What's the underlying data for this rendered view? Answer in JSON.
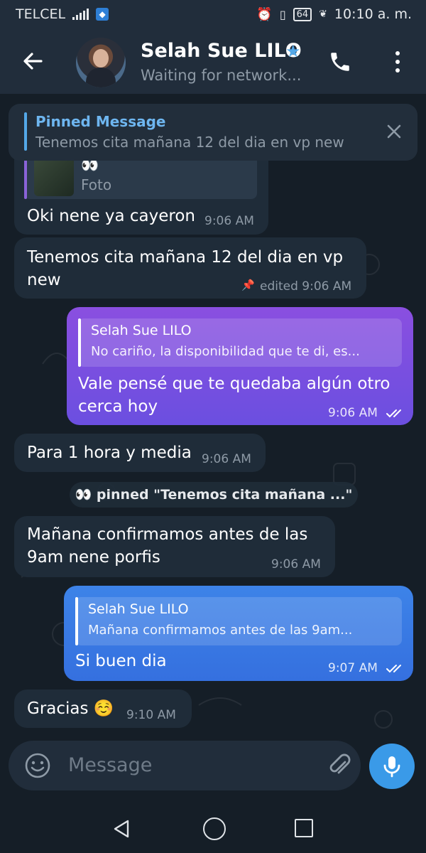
{
  "status_bar": {
    "carrier": "TELCEL",
    "battery": "64",
    "time": "10:10 a. m."
  },
  "header": {
    "contact_name": "Selah Sue LILO",
    "status": "Waiting for network..."
  },
  "pinned": {
    "title": "Pinned Message",
    "text": "Tenemos cita mañana 12 del dia en vp new"
  },
  "messages": {
    "m1": {
      "reply_label": "Foto",
      "reply_emoji": "👀",
      "text": "Oki nene ya cayeron",
      "time": "9:06 AM"
    },
    "m2": {
      "text_line1": "Tenemos cita mañana 12 del dia en vp",
      "text_line2": "new",
      "time": "edited 9:06 AM"
    },
    "m3": {
      "reply_name": "Selah Sue LILO",
      "reply_text": "No cariño, la disponibilidad que te di, es...",
      "text_line1": "Vale pensé que te quedaba algún otro",
      "text_line2": "cerca hoy",
      "time": "9:06 AM"
    },
    "m4": {
      "text": "Para 1 hora y media",
      "time": "9:06 AM"
    },
    "service": "👀 pinned \"Tenemos cita mañana ...\"",
    "m5": {
      "text_line1": "Mañana confirmamos antes de las",
      "text_line2": "9am nene porfis",
      "time": "9:06 AM"
    },
    "m6": {
      "reply_name": "Selah Sue LILO",
      "reply_text": "Mañana confirmamos antes de las 9am...",
      "text": "Si buen dia",
      "time": "9:07 AM"
    },
    "m7": {
      "text": "Gracias ☺️",
      "time": "9:10 AM"
    }
  },
  "composer": {
    "placeholder": "Message"
  },
  "colors": {
    "background": "#151e27",
    "header": "#212d3b",
    "incoming_bubble": "#1f2c39",
    "outgoing_purple": "#7a4fe0",
    "outgoing_blue": "#3a7ae4",
    "accent": "#54a8e8"
  }
}
